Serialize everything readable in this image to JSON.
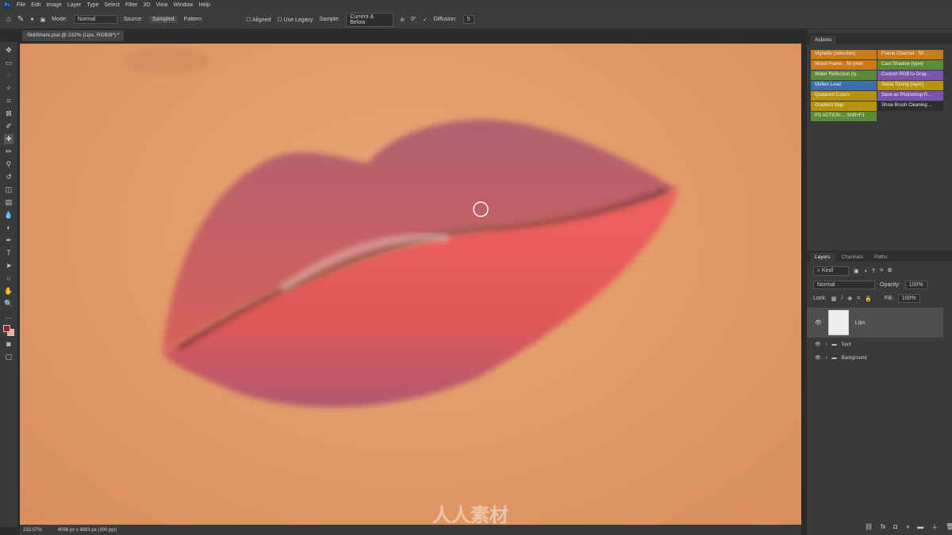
{
  "menu": [
    "File",
    "Edit",
    "Image",
    "Layer",
    "Type",
    "Select",
    "Filter",
    "3D",
    "View",
    "Window",
    "Help"
  ],
  "app_icon": "Ps",
  "options": {
    "mode_label": "Mode:",
    "mode_value": "Normal",
    "source_label": "Source:",
    "sampled": "Sampled",
    "pattern": "Pattern",
    "aligned": "Aligned",
    "use_legacy": "Use Legacy",
    "sample_label": "Sample:",
    "sample_value": "Current & Below",
    "angle": "0°",
    "diffusion_label": "Diffusion:",
    "diffusion_value": "5"
  },
  "document_tab": "SkillShare.psd @ 232% (Lips, RGB/8*) *",
  "status": {
    "zoom": "232.07%",
    "doc_size": "4096 px x 4893 px (300 ppi)"
  },
  "actions": {
    "title": "Actions",
    "items": [
      {
        "label": "Vignette (selection)",
        "color": "#c87a1c"
      },
      {
        "label": "Frame Channel - 50 ...",
        "color": "#c87a1c"
      },
      {
        "label": "Wood Frame - 50 pixel",
        "color": "#c87a1c"
      },
      {
        "label": "Cast Shadow (type)",
        "color": "#5b8a3a"
      },
      {
        "label": "Water Reflection (ty...",
        "color": "#5b8a3a"
      },
      {
        "label": "Custom RGB to Gray...",
        "color": "#7a52b0"
      },
      {
        "label": "Molten Lead",
        "color": "#3f6fa8"
      },
      {
        "label": "Sepia Toning (layer)",
        "color": "#b8920f"
      },
      {
        "label": "Quadrant Colors",
        "color": "#b8920f"
      },
      {
        "label": "Save as Photoshop P...",
        "color": "#7a52b0"
      },
      {
        "label": "Gradient Map",
        "color": "#b8920f"
      },
      {
        "label": "Show Brush Cleaning ...",
        "color": "#2c2c2c"
      },
      {
        "label": "PS ACTION ...   Shift+F1",
        "color": "#5b8a3a"
      }
    ]
  },
  "layers": {
    "tabs": [
      "Layers",
      "Channels",
      "Paths"
    ],
    "filter": "Kind",
    "blend": "Normal",
    "opacity_label": "Opacity:",
    "opacity": "100%",
    "lock_label": "Lock:",
    "fill_label": "Fill:",
    "fill": "100%",
    "items": [
      {
        "name": "Lips",
        "type": "layer"
      },
      {
        "name": "Spot",
        "type": "group"
      },
      {
        "name": "Background",
        "type": "group"
      }
    ]
  },
  "watermark": "人人素材"
}
